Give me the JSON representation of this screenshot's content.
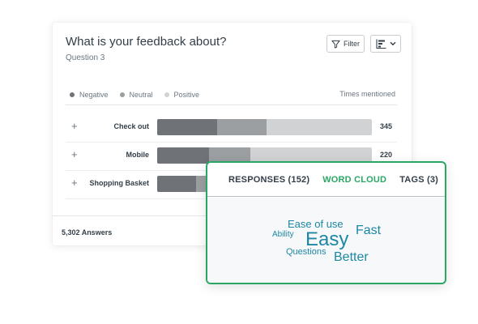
{
  "card": {
    "title": "What is your feedback about?",
    "subtitle": "Question 3",
    "filter_label": "Filter",
    "filter_icon": "funnel-icon",
    "chart_icon": "bar-chart-icon",
    "dropdown_icon": "chevron-down-icon",
    "legend": [
      {
        "label": "Negative",
        "color": "#6f7276"
      },
      {
        "label": "Neutral",
        "color": "#9c9fa2"
      },
      {
        "label": "Positive",
        "color": "#d0d2d4"
      }
    ],
    "times_label": "Times mentioned",
    "rows": [
      {
        "label": "Check out",
        "count": "345",
        "negative": 0.28,
        "neutral": 0.23
      },
      {
        "label": "Mobile",
        "count": "220",
        "negative": 0.24,
        "neutral": 0.195
      },
      {
        "label": "Shopping Basket",
        "count": "",
        "negative": 0.18,
        "neutral": 0.1
      }
    ],
    "answers": "5,302 Answers"
  },
  "wordcloud": {
    "tabs": [
      {
        "label": "RESPONSES (152)",
        "active": false
      },
      {
        "label": "WORD CLOUD",
        "active": true
      },
      {
        "label": "TAGS (3)",
        "active": false
      }
    ],
    "words": [
      {
        "text": "Ease of use",
        "size": 13
      },
      {
        "text": "Ability",
        "size": 10
      },
      {
        "text": "Easy",
        "size": 24
      },
      {
        "text": "Fast",
        "size": 16
      },
      {
        "text": "Questions",
        "size": 11
      },
      {
        "text": "Better",
        "size": 16
      }
    ],
    "accent": "#2aa665",
    "word_color": "#1d87a5"
  }
}
